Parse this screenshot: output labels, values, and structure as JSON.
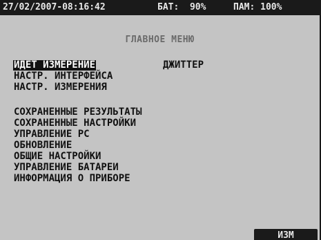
{
  "status_bar": {
    "datetime": "27/02/2007-08:16:42",
    "battery": "БАТ:  90%",
    "memory": "ПАМ: 100%"
  },
  "menu": {
    "title": "ГЛАВНОЕ МЕНЮ",
    "selected_item": "ИДЕТ ИЗМЕРЕНИЕ",
    "selected_item_status": "ДЖИТТЕР",
    "group1": [
      "НАСТР. ИНТЕРФЕЙСА",
      "НАСТР. ИЗМЕРЕНИЯ"
    ],
    "group2": [
      "СОХРАНЕННЫЕ РЕЗУЛЬТАТЫ",
      "СОХРАНЕННЫЕ НАСТРОЙКИ",
      "УПРАВЛЕНИЕ PC",
      "ОБНОВЛЕНИЕ",
      "ОБЩИЕ НАСТРОЙКИ",
      "УПРАВЛЕНИЕ БАТАРЕИ",
      "ИНФОРМАЦИЯ О ПРИБОРЕ"
    ]
  },
  "softkeys": {
    "right_label": "ИЗМ"
  },
  "colors": {
    "screen_background": "#c4c4c4",
    "bar_background": "#1a1a1a",
    "bar_text": "#e8e8e8",
    "title_text": "#6a6a6a",
    "item_text": "#111111"
  }
}
